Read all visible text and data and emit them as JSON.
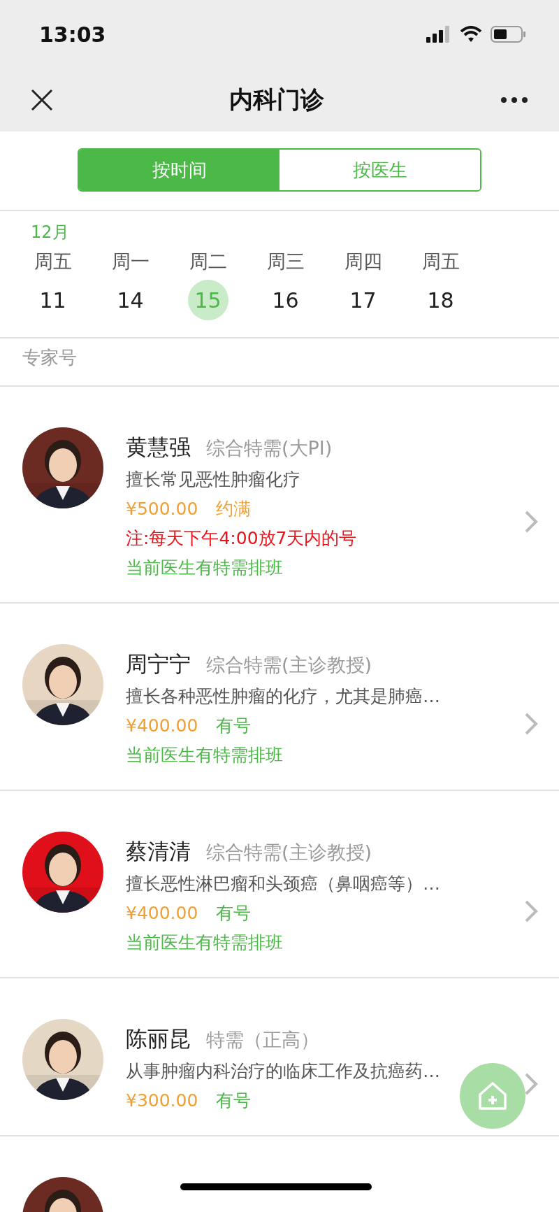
{
  "status_bar": {
    "time": "13:03"
  },
  "nav": {
    "title": "内科门诊"
  },
  "tabs": [
    {
      "label": "按时间",
      "selected": true
    },
    {
      "label": "按医生",
      "selected": false
    }
  ],
  "calendar": {
    "month": "12月",
    "days": [
      {
        "weekday": "周五",
        "date": "11",
        "selected": false
      },
      {
        "weekday": "周一",
        "date": "14",
        "selected": false
      },
      {
        "weekday": "周二",
        "date": "15",
        "selected": true
      },
      {
        "weekday": "周三",
        "date": "16",
        "selected": false
      },
      {
        "weekday": "周四",
        "date": "17",
        "selected": false
      },
      {
        "weekday": "周五",
        "date": "18",
        "selected": false
      }
    ]
  },
  "section_label": "专家号",
  "doctors": [
    {
      "name": "黄慧强",
      "title": "综合特需(大PI)",
      "description": "擅长常见恶性肿瘤化疗",
      "price": "¥500.00",
      "availability": {
        "text": "约满",
        "kind": "full"
      },
      "note": "注:每天下午4:00放7天内的号",
      "schedule": "当前医生有特需排班"
    },
    {
      "name": "周宁宁",
      "title": "综合特需(主诊教授)",
      "description": "擅长各种恶性肿瘤的化疗，尤其是肺癌…",
      "price": "¥400.00",
      "availability": {
        "text": "有号",
        "kind": "available"
      },
      "schedule": "当前医生有特需排班"
    },
    {
      "name": "蔡清清",
      "title": "综合特需(主诊教授)",
      "description": "擅长恶性淋巴瘤和头颈癌（鼻咽癌等）…",
      "price": "¥400.00",
      "availability": {
        "text": "有号",
        "kind": "available"
      },
      "schedule": "当前医生有特需排班"
    },
    {
      "name": "陈丽昆",
      "title": "特需（正高）",
      "description": "从事肿瘤内科治疗的临床工作及抗癌药…",
      "price": "¥300.00",
      "availability": {
        "text": "有号",
        "kind": "available"
      }
    }
  ]
}
